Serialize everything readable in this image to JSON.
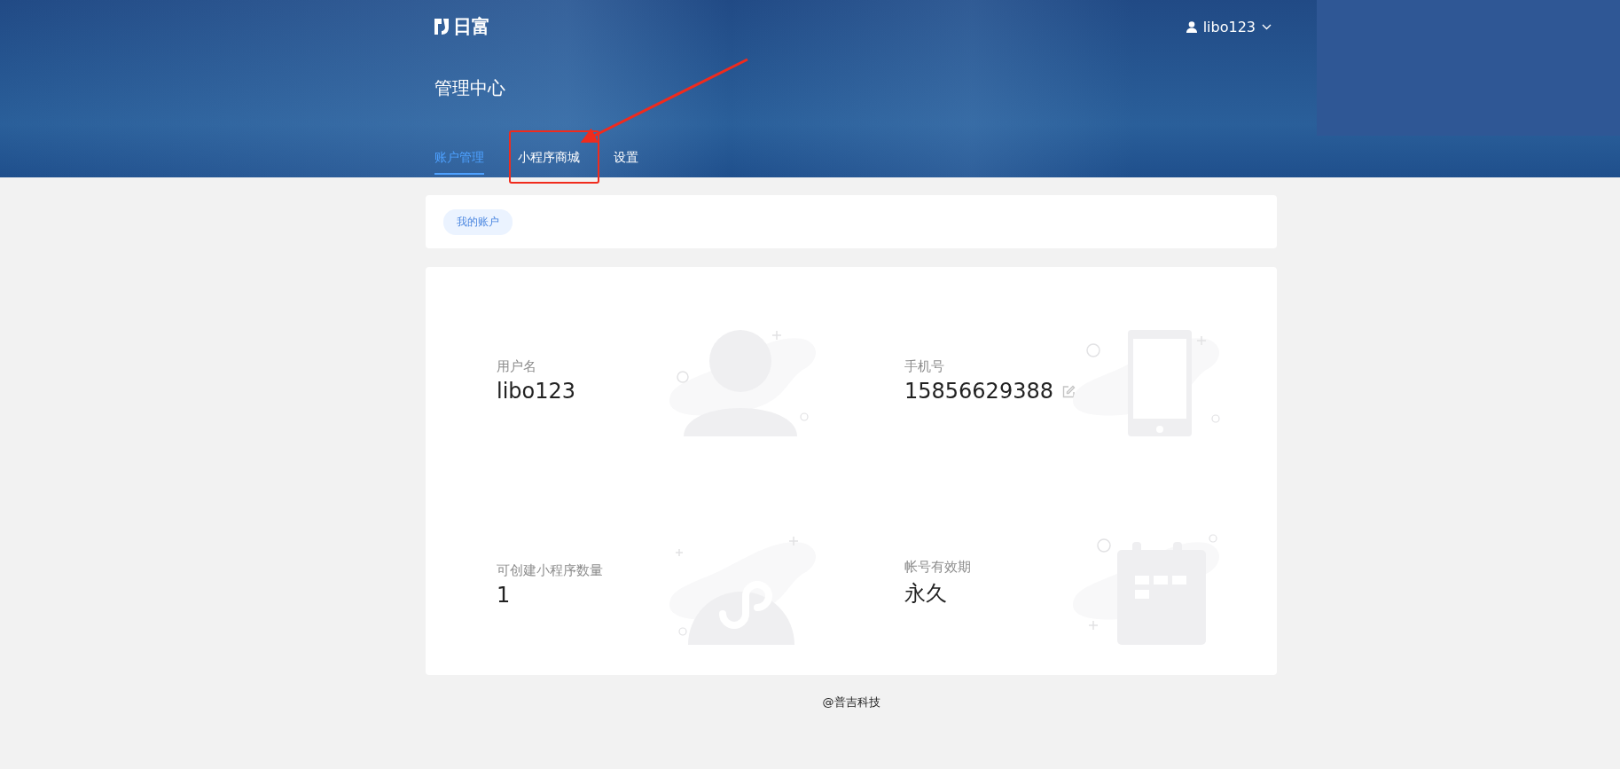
{
  "logo": {
    "text": "日富"
  },
  "user_menu": {
    "name": "libo123"
  },
  "page_title": "管理中心",
  "tabs": [
    {
      "label": "账户管理",
      "selected": true
    },
    {
      "label": "小程序商城",
      "selected": false
    },
    {
      "label": "设置",
      "selected": false
    }
  ],
  "sub_tabs": [
    {
      "label": "我的账户",
      "selected": true
    }
  ],
  "info": [
    {
      "kind": "user",
      "label": "用户名",
      "value": "libo123",
      "editable": false
    },
    {
      "kind": "phone",
      "label": "手机号",
      "value": "15856629388",
      "editable": true
    },
    {
      "kind": "miniprogram",
      "label": "可创建小程序数量",
      "value": "1",
      "editable": false
    },
    {
      "kind": "calendar",
      "label": "帐号有效期",
      "value": "永久",
      "editable": false
    }
  ],
  "footer": "@普吉科技"
}
